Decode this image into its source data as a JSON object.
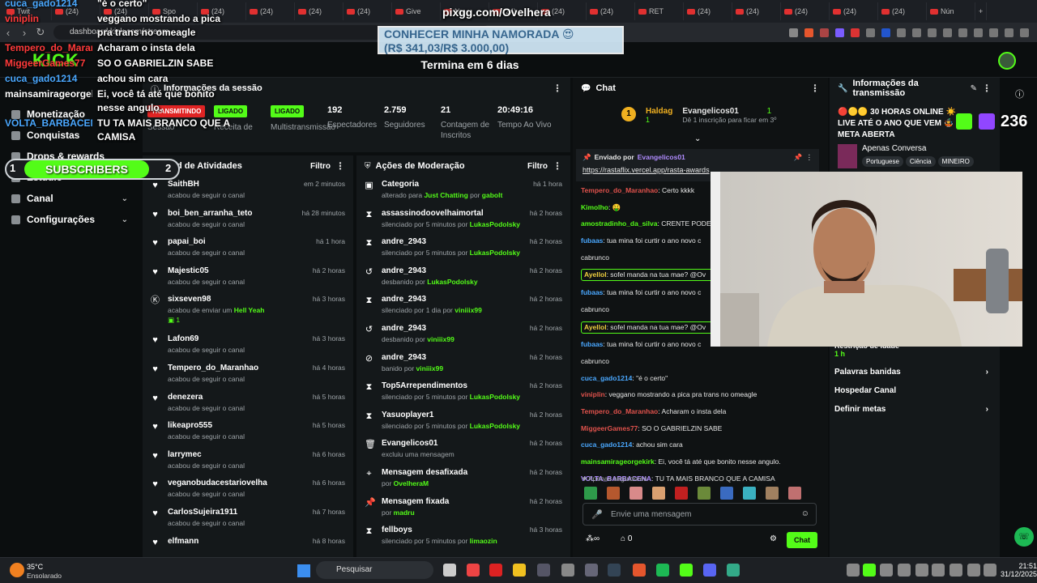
{
  "browser": {
    "tabs": [
      "Twit",
      "(24)",
      "(24)",
      "Spo",
      "(24)",
      "(24)",
      "(24)",
      "(24)",
      "Give",
      "Nu",
      "(24)",
      "(24)",
      "(24)",
      "RET",
      "(24)",
      "(24)",
      "(24)",
      "(24)",
      "(24)",
      "Nún"
    ],
    "url": "dashboard.kick.com/stream",
    "new_tab": "+"
  },
  "overlay": {
    "pixgg": "pixgg.com/Ovelhera",
    "goal_title": "CONHECER MINHA NAMORADA 😍",
    "goal_amount": "(R$ 341,03/R$ 3.000,00)",
    "timer": "Termina em 6 dias",
    "subs_num": "1",
    "subs_label": "SUBSCRIBERS",
    "subs_goal": "2",
    "viewer_count": "236",
    "chat_lines": [
      {
        "user": "cuca_gado1214",
        "text": "\"é o certo\"",
        "color": "#4aa8ff"
      },
      {
        "user": "viniplin",
        "text": "veggano mostrando a pica pra trans no omeagle",
        "color": "#ff3a3a"
      },
      {
        "user": "Tempero_do_Maranhao",
        "text": "Acharam o insta dela",
        "color": "#ff3a3a"
      },
      {
        "user": "MiggeerGames77",
        "text": "SO O GABRIELZIN SABE",
        "color": "#ff3a3a"
      },
      {
        "user": "cuca_gado1214",
        "text": "achou sim cara",
        "color": "#4aa8ff"
      },
      {
        "user": "mainsamirageorgekirk",
        "text": "Ei, você tá até que bonito nesse angulo.",
        "color": "#fff"
      },
      {
        "user": "VOLTA_BARBACENA",
        "text": "TU TA MAIS BRANCO QUE A CAMISA",
        "color": "#4aa8ff"
      }
    ]
  },
  "sidebar": {
    "items": [
      {
        "label": "Monetização",
        "icon": "monetization-icon"
      },
      {
        "label": "Conquistas",
        "icon": "trophy-icon"
      },
      {
        "label": "Drops & rewards",
        "icon": "gift-icon"
      },
      {
        "label": "Estúdio",
        "icon": "studio-icon"
      },
      {
        "label": "Canal",
        "icon": "channel-icon"
      },
      {
        "label": "Configurações",
        "icon": "gear-icon"
      }
    ]
  },
  "session": {
    "title": "Informações da sessão",
    "live_badge": "TRANSMITINDO",
    "live_caption": "Sessão",
    "stats": [
      {
        "value": "LIGADO",
        "label": "Receita de",
        "badge": true
      },
      {
        "value": "LIGADO",
        "label": "Multistransmissão",
        "badge": true
      },
      {
        "value": "192",
        "label": "Espectadores"
      },
      {
        "value": "2.759",
        "label": "Seguidores"
      },
      {
        "value": "21",
        "label": "Contagem de Inscritos"
      },
      {
        "value": "20:49:16",
        "label": "Tempo Ao Vivo"
      }
    ]
  },
  "feed": {
    "title": "Feed de Atividades",
    "filter": "Filtro",
    "rows": [
      {
        "name": "SaithBH",
        "desc": "acabou de seguir o canal",
        "time": "em 2 minutos",
        "icon": "heart"
      },
      {
        "name": "boi_ben_arranha_teto",
        "desc": "acabou de seguir o canal",
        "time": "há 28 minutos",
        "icon": "heart"
      },
      {
        "name": "papai_boi",
        "desc": "acabou de seguir o canal",
        "time": "há 1 hora",
        "icon": "heart"
      },
      {
        "name": "Majestic05",
        "desc": "acabou de seguir o canal",
        "time": "há 2 horas",
        "icon": "heart"
      },
      {
        "name": "sixseven98",
        "desc": "acabou de enviar um ",
        "desc_b": "Hell Yeah",
        "extra": "1",
        "time": "há 3 horas",
        "icon": "kick"
      },
      {
        "name": "Lafon69",
        "desc": "acabou de seguir o canal",
        "time": "há 3 horas",
        "icon": "heart"
      },
      {
        "name": "Tempero_do_Maranhao",
        "desc": "acabou de seguir o canal",
        "time": "há 4 horas",
        "icon": "heart"
      },
      {
        "name": "denezera",
        "desc": "acabou de seguir o canal",
        "time": "há 5 horas",
        "icon": "heart"
      },
      {
        "name": "likeapro555",
        "desc": "acabou de seguir o canal",
        "time": "há 5 horas",
        "icon": "heart"
      },
      {
        "name": "larrymec",
        "desc": "acabou de seguir o canal",
        "time": "há 6 horas",
        "icon": "heart"
      },
      {
        "name": "veganobudacestariovelha",
        "desc": "acabou de seguir o canal",
        "time": "há 6 horas",
        "icon": "heart"
      },
      {
        "name": "CarlosSujeira1911",
        "desc": "acabou de seguir o canal",
        "time": "há 7 horas",
        "icon": "heart"
      },
      {
        "name": "elfmann",
        "desc": "",
        "time": "há 8 horas",
        "icon": "heart"
      }
    ]
  },
  "moderation": {
    "title": "Ações de Moderação",
    "filter": "Filtro",
    "rows": [
      {
        "name": "Categoria",
        "desc": "alterado para ",
        "b1": "Just Chatting",
        "mid": " por ",
        "b2": "gabolt",
        "time": "há 1 hora",
        "icon": "tag"
      },
      {
        "name": "assassinodoovelhaimortal",
        "desc": "silenciado por 5 minutos por ",
        "b1": "LukasPodolsky",
        "time": "há 2 horas",
        "icon": "hourglass"
      },
      {
        "name": "andre_2943",
        "desc": "silenciado por 5 minutos por ",
        "b1": "LukasPodolsky",
        "time": "há 2 horas",
        "icon": "hourglass"
      },
      {
        "name": "andre_2943",
        "desc": "desbanido por ",
        "b1": "LukasPodolsky",
        "time": "há 2 horas",
        "icon": "undo"
      },
      {
        "name": "andre_2943",
        "desc": "silenciado por 1 dia por ",
        "b1": "viniiix99",
        "time": "há 2 horas",
        "icon": "hourglass"
      },
      {
        "name": "andre_2943",
        "desc": "desbanido por ",
        "b1": "viniiix99",
        "time": "há 2 horas",
        "icon": "undo"
      },
      {
        "name": "andre_2943",
        "desc": "banido por ",
        "b1": "viniiix99",
        "time": "há 2 horas",
        "icon": "ban"
      },
      {
        "name": "Top5Arrependimentos",
        "desc": "silenciado por 5 minutos por ",
        "b1": "LukasPodolsky",
        "time": "há 2 horas",
        "icon": "hourglass"
      },
      {
        "name": "Yasuoplayer1",
        "desc": "silenciado por 5 minutos por ",
        "b1": "LukasPodolsky",
        "time": "há 2 horas",
        "icon": "hourglass"
      },
      {
        "name": "Evangelicos01",
        "desc": "excluiu uma mensagem",
        "time": "há 2 horas",
        "icon": "trash"
      },
      {
        "name": "Mensagem desafixada",
        "desc": "por ",
        "b1": "OvelheraM",
        "time": "há 2 horas",
        "icon": "unpin"
      },
      {
        "name": "Mensagem fixada",
        "desc": "por ",
        "b1": "madru",
        "time": "há 2 horas",
        "icon": "pin"
      },
      {
        "name": "fellboys",
        "desc": "silenciado por 5 minutos por ",
        "b1": "limaozin",
        "time": "há 3 horas",
        "icon": "hourglass"
      }
    ]
  },
  "chat": {
    "title": "Chat",
    "top_gifter": {
      "user": "Haldag",
      "count": "1",
      "user2": "Evangelicos01",
      "count2": "1",
      "note": "Dê 1 inscrição para ficar em 3º"
    },
    "pinned_by": "Enviado por",
    "pinned_user": "Evangelicos01",
    "pinned_link": "https://rastaflix.vercel.app/rasta-awards",
    "messages": [
      {
        "user": "Tempero_do_Maranhao",
        "text": "Certo kkkk",
        "color": "#e0524c"
      },
      {
        "user": "Kimolho",
        "text": "🤑",
        "color": "#53fc18"
      },
      {
        "user": "amostradinho_da_silva",
        "text": "CRENTE PODE",
        "color": "#53fc18"
      },
      {
        "user": "fubaas",
        "text": "tua mina foi curtir o ano novo c",
        "color": "#4aa8ff"
      },
      {
        "user": "",
        "text": "cabrunco",
        "color": "#fff"
      },
      {
        "user": "Ayellol",
        "text": "sofel manda na tua mae? @Ov",
        "color": "#f0d040",
        "boxed": true
      },
      {
        "user": "fubaas",
        "text": "tua mina foi curtir o ano novo c",
        "color": "#4aa8ff"
      },
      {
        "user": "",
        "text": "cabrunco",
        "color": "#fff"
      },
      {
        "user": "Ayellol",
        "text": "sofel manda na tua mae? @Ov",
        "color": "#f0d040",
        "boxed": true
      },
      {
        "user": "fubaas",
        "text": "tua mina foi curtir o ano novo c",
        "color": "#4aa8ff"
      },
      {
        "user": "",
        "text": "cabrunco",
        "color": "#fff"
      },
      {
        "user": "cuca_gado1214",
        "text": "\"é o certo\"",
        "color": "#4aa8ff"
      },
      {
        "user": "viniplin",
        "text": "veggano mostrando a pica pra trans no omeagle",
        "color": "#e0524c"
      },
      {
        "user": "Tempero_do_Maranhao",
        "text": "Acharam o insta dela",
        "color": "#e0524c"
      },
      {
        "user": "MiggeerGames77",
        "text": "SO O GABRIELZIN SABE",
        "color": "#e0524c"
      },
      {
        "user": "cuca_gado1214",
        "text": "achou sim cara",
        "color": "#4aa8ff"
      },
      {
        "user": "mainsamirageorgekirk",
        "text": "Ei, você tá até que bonito nesse angulo.",
        "color": "#53fc18"
      },
      {
        "user": "VOLTA_BARBACENA",
        "text": "TU TA MAIS BRANCO QUE A CAMISA",
        "color": "#b08cff"
      }
    ],
    "followers_only": "Apenas seguidores",
    "input_placeholder": "Envie uma mensagem",
    "points": "0",
    "send": "Chat"
  },
  "transmission": {
    "title": "Informações da transmissão",
    "stream_title": "🔴🟡🟡 30 HORAS ONLINE ☀️ LIVE ATÉ O ANO QUE VEM 🤹 META ABERTA",
    "category": "Apenas Conversa",
    "tags": [
      "Portuguese",
      "Ciência",
      "MINEIRO"
    ],
    "slow_mode": "Restrição de idade",
    "slow_value": "1 h",
    "links": [
      "Palavras banidas",
      "Hospedar Canal",
      "Definir metas"
    ]
  },
  "taskbar": {
    "weather_temp": "35°C",
    "weather_desc": "Ensolarado",
    "search": "Pesquisar",
    "time": "21:51",
    "date": "31/12/2025"
  }
}
